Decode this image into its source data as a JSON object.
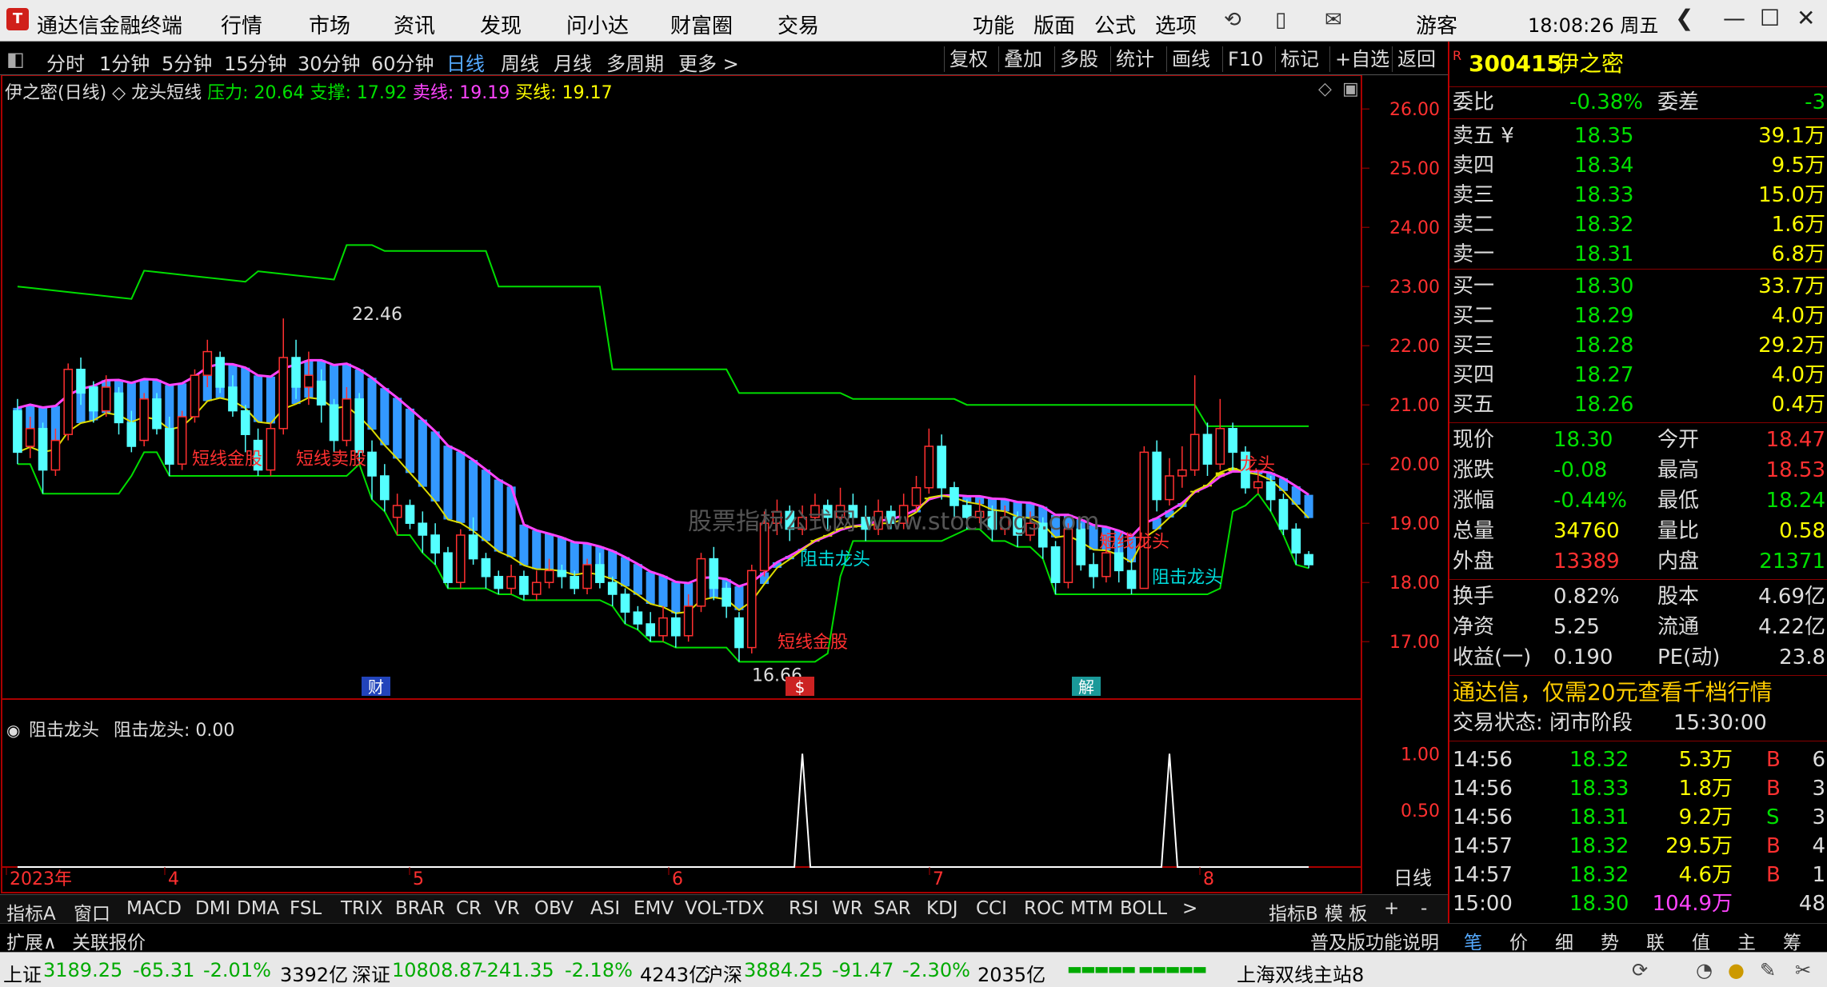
{
  "title_bar": {
    "app_title": "通达信金融终端",
    "menu": [
      "行情",
      "市场",
      "资讯",
      "发现",
      "问小达",
      "财富圈",
      "交易"
    ],
    "right_menu": [
      "功能",
      "版面",
      "公式",
      "选项"
    ],
    "user": "游客",
    "clock": "18:08:26 周五"
  },
  "periods": [
    "分时",
    "1分钟",
    "5分钟",
    "15分钟",
    "30分钟",
    "60分钟",
    "日线",
    "周线",
    "月线",
    "多周期",
    "更多 >"
  ],
  "active_period": "日线",
  "right_toolbar": [
    "复权",
    "叠加",
    "多股",
    "统计",
    "画线",
    "F10",
    "标记",
    "+自选",
    "返回"
  ],
  "chart_header": {
    "name": "伊之密(日线)",
    "indicator": "龙头短线",
    "pressure_label": "压力: 20.64",
    "support_label": "支撑: 17.92",
    "sell_label": "卖线: 19.19",
    "buy_label": "买线: 19.17"
  },
  "price_axis": [
    "26.00",
    "25.00",
    "24.00",
    "23.00",
    "22.00",
    "21.00",
    "20.00",
    "19.00",
    "18.00",
    "17.00"
  ],
  "annotations": {
    "high_label": "22.46",
    "low_label": "16.66",
    "a1": "短线金股",
    "a2": "短线卖股",
    "a3": "短线金股",
    "a4": "阻击龙头",
    "a5": "阻击龙头",
    "a6": "龙头",
    "a7": "短线龙头",
    "watermark": "股票指标公式网 www.stocklogs.com"
  },
  "event_tags": [
    "财",
    "$",
    "解"
  ],
  "sub_chart": {
    "title": "阻击龙头",
    "value_label": "阻击龙头: 0.00",
    "axis": [
      "1.00",
      "0.50"
    ]
  },
  "date_axis": [
    "2023年",
    "4",
    "5",
    "6",
    "7",
    "8"
  ],
  "date_axis_right": "日线",
  "indicator_tabs": [
    "指标A",
    "窗口",
    "MACD",
    "DMI",
    "DMA",
    "FSL",
    "TRIX",
    "BRAR",
    "CR",
    "VR",
    "OBV",
    "ASI",
    "EMV",
    "VOL-TDX",
    "RSI",
    "WR",
    "SAR",
    "KDJ",
    "CCI",
    "ROC",
    "MTM",
    "BOLL",
    ">",
    "指标B",
    "模 板",
    "+",
    "-"
  ],
  "expand_tabs": [
    "扩展∧",
    "关联报价"
  ],
  "quote": {
    "code": "300415",
    "name": "伊之密",
    "weibi_label": "委比",
    "weibi": "-0.38%",
    "weicha_label": "委差",
    "weicha": "-3",
    "asks": [
      {
        "label": "卖五 ¥",
        "price": "18.35",
        "vol": "39.1万"
      },
      {
        "label": "卖四",
        "price": "18.34",
        "vol": "9.5万"
      },
      {
        "label": "卖三",
        "price": "18.33",
        "vol": "15.0万"
      },
      {
        "label": "卖二",
        "price": "18.32",
        "vol": "1.6万"
      },
      {
        "label": "卖一",
        "price": "18.31",
        "vol": "6.8万"
      }
    ],
    "bids": [
      {
        "label": "买一",
        "price": "18.30",
        "vol": "33.7万"
      },
      {
        "label": "买二",
        "price": "18.29",
        "vol": "4.0万"
      },
      {
        "label": "买三",
        "price": "18.28",
        "vol": "29.2万"
      },
      {
        "label": "买四",
        "price": "18.27",
        "vol": "4.0万"
      },
      {
        "label": "买五",
        "price": "18.26",
        "vol": "0.4万"
      }
    ],
    "stats": [
      {
        "l1": "现价",
        "v1": "18.30",
        "l2": "今开",
        "v2": "18.47"
      },
      {
        "l1": "涨跌",
        "v1": "-0.08",
        "l2": "最高",
        "v2": "18.53"
      },
      {
        "l1": "涨幅",
        "v1": "-0.44%",
        "l2": "最低",
        "v2": "18.24"
      },
      {
        "l1": "总量",
        "v1": "34760",
        "l2": "量比",
        "v2": "0.58"
      },
      {
        "l1": "外盘",
        "v1": "13389",
        "l2": "内盘",
        "v2": "21371"
      }
    ],
    "stats2": [
      {
        "l1": "换手",
        "v1": "0.82%",
        "l2": "股本",
        "v2": "4.69亿"
      },
      {
        "l1": "净资",
        "v1": "5.25",
        "l2": "流通",
        "v2": "4.22亿"
      },
      {
        "l1": "收益(一)",
        "v1": "0.190",
        "l2": "PE(动)",
        "v2": "23.8"
      }
    ],
    "ad": "通达信，仅需20元查看千档行情",
    "trade_state_label": "交易状态: 闭市阶段",
    "trade_state_time": "15:30:00",
    "ticks": [
      {
        "t": "14:56",
        "p": "18.32",
        "v": "5.3万",
        "s": "B",
        "n": "6"
      },
      {
        "t": "14:56",
        "p": "18.33",
        "v": "1.8万",
        "s": "B",
        "n": "3"
      },
      {
        "t": "14:56",
        "p": "18.31",
        "v": "9.2万",
        "s": "S",
        "n": "3"
      },
      {
        "t": "14:57",
        "p": "18.32",
        "v": "29.5万",
        "s": "B",
        "n": "4"
      },
      {
        "t": "14:57",
        "p": "18.32",
        "v": "4.6万",
        "s": "B",
        "n": "1"
      },
      {
        "t": "15:00",
        "p": "18.30",
        "v": "104.9万",
        "s": "",
        "n": "48"
      }
    ],
    "tabs": [
      "笔",
      "价",
      "细",
      "势",
      "联",
      "值",
      "主",
      "筹"
    ],
    "func_note": "普及版功能说明"
  },
  "status_bar": {
    "sh_label": "上证",
    "sh_val": "3189.25",
    "sh_chg": "-65.31",
    "sh_pct": "-2.01%",
    "sh_amt": "3392亿",
    "sz_label": "深证",
    "sz_val": "10808.87",
    "sz_chg": "-241.35",
    "sz_pct": "-2.18%",
    "sz_amt": "4243亿",
    "hs_label": "沪深",
    "hs_val": "3884.25",
    "hs_chg": "-91.47",
    "hs_pct": "-2.30%",
    "hs_amt": "2035亿",
    "server": "上海双线主站8"
  },
  "chart_data": {
    "type": "candlestick",
    "ylim": [
      16.3,
      26.3
    ],
    "sub_ylim": [
      0,
      1.2
    ],
    "candles": [
      [
        20.9,
        20.2,
        21.1,
        20.0
      ],
      [
        20.3,
        20.6,
        20.8,
        20.1
      ],
      [
        20.6,
        19.9,
        20.7,
        19.5
      ],
      [
        19.9,
        20.4,
        20.6,
        19.8
      ],
      [
        20.5,
        21.6,
        21.7,
        20.4
      ],
      [
        21.6,
        21.2,
        21.8,
        21.0
      ],
      [
        21.3,
        20.9,
        21.4,
        20.7
      ],
      [
        20.9,
        21.3,
        21.5,
        20.8
      ],
      [
        21.2,
        20.7,
        21.3,
        20.5
      ],
      [
        20.7,
        20.3,
        20.9,
        20.2
      ],
      [
        20.4,
        21.1,
        21.2,
        20.3
      ],
      [
        21.1,
        20.6,
        21.2,
        20.5
      ],
      [
        20.6,
        20.0,
        20.8,
        19.8
      ],
      [
        20.0,
        20.8,
        20.9,
        19.9
      ],
      [
        20.8,
        21.5,
        21.6,
        20.7
      ],
      [
        21.5,
        21.9,
        22.1,
        21.3
      ],
      [
        21.8,
        21.3,
        21.9,
        21.2
      ],
      [
        21.3,
        20.9,
        21.5,
        20.8
      ],
      [
        20.9,
        20.5,
        21.0,
        20.2
      ],
      [
        20.4,
        19.9,
        20.6,
        19.8
      ],
      [
        19.9,
        20.6,
        20.7,
        19.8
      ],
      [
        20.6,
        21.8,
        22.46,
        20.5
      ],
      [
        21.8,
        21.3,
        22.1,
        21.1
      ],
      [
        21.3,
        21.5,
        21.9,
        21.0
      ],
      [
        21.4,
        21.0,
        21.6,
        20.7
      ],
      [
        21.0,
        20.4,
        21.1,
        20.2
      ],
      [
        20.4,
        21.1,
        21.3,
        20.3
      ],
      [
        21.1,
        20.2,
        21.2,
        20.0
      ],
      [
        20.2,
        19.8,
        20.4,
        19.4
      ],
      [
        19.8,
        19.4,
        20.0,
        19.2
      ],
      [
        19.1,
        19.3,
        19.5,
        18.8
      ],
      [
        19.3,
        19.0,
        19.4,
        18.9
      ],
      [
        19.0,
        18.8,
        19.2,
        18.5
      ],
      [
        18.8,
        18.5,
        19.0,
        18.3
      ],
      [
        18.5,
        18.0,
        18.6,
        17.9
      ],
      [
        18.0,
        18.8,
        18.9,
        17.9
      ],
      [
        18.8,
        18.4,
        19.1,
        18.3
      ],
      [
        18.4,
        18.1,
        18.5,
        17.9
      ],
      [
        18.1,
        17.9,
        18.2,
        17.8
      ],
      [
        17.9,
        18.1,
        18.3,
        17.8
      ],
      [
        18.1,
        17.8,
        18.2,
        17.7
      ],
      [
        17.8,
        18.0,
        18.2,
        17.7
      ],
      [
        18.0,
        18.2,
        18.4,
        17.9
      ],
      [
        18.2,
        18.1,
        18.3,
        17.9
      ],
      [
        18.1,
        17.9,
        18.2,
        17.8
      ],
      [
        17.9,
        18.3,
        18.4,
        17.8
      ],
      [
        18.3,
        18.0,
        18.5,
        17.9
      ],
      [
        18.0,
        17.8,
        18.1,
        17.6
      ],
      [
        17.8,
        17.5,
        17.9,
        17.3
      ],
      [
        17.5,
        17.3,
        17.6,
        17.2
      ],
      [
        17.3,
        17.1,
        17.5,
        17.0
      ],
      [
        17.1,
        17.4,
        17.6,
        17.0
      ],
      [
        17.4,
        17.1,
        17.5,
        16.9
      ],
      [
        17.1,
        17.6,
        17.8,
        17.0
      ],
      [
        17.6,
        18.4,
        18.5,
        17.5
      ],
      [
        18.4,
        17.9,
        18.6,
        17.7
      ],
      [
        17.9,
        17.6,
        18.0,
        17.4
      ],
      [
        17.4,
        16.9,
        17.5,
        16.66
      ],
      [
        16.9,
        18.2,
        18.3,
        16.8
      ],
      [
        18.2,
        19.0,
        19.2,
        18.1
      ],
      [
        19.0,
        19.2,
        19.4,
        18.8
      ],
      [
        19.2,
        18.9,
        19.3,
        18.7
      ],
      [
        18.9,
        19.1,
        19.3,
        18.8
      ],
      [
        19.1,
        19.3,
        19.5,
        19.0
      ],
      [
        19.3,
        19.1,
        19.4,
        18.9
      ],
      [
        19.1,
        19.3,
        19.6,
        19.0
      ],
      [
        19.3,
        19.1,
        19.5,
        18.9
      ],
      [
        19.1,
        18.9,
        19.3,
        18.7
      ],
      [
        18.9,
        19.2,
        19.4,
        18.8
      ],
      [
        19.2,
        19.0,
        19.3,
        18.9
      ],
      [
        19.0,
        19.3,
        19.5,
        18.9
      ],
      [
        19.3,
        19.6,
        19.8,
        19.2
      ],
      [
        19.6,
        20.3,
        20.6,
        19.5
      ],
      [
        20.3,
        19.6,
        20.5,
        19.4
      ],
      [
        19.6,
        19.3,
        19.7,
        19.1
      ],
      [
        19.3,
        19.1,
        19.4,
        18.9
      ],
      [
        19.1,
        19.2,
        19.4,
        19.0
      ],
      [
        19.2,
        18.9,
        19.3,
        18.7
      ],
      [
        18.9,
        19.1,
        19.3,
        18.8
      ],
      [
        19.1,
        18.8,
        19.2,
        18.6
      ],
      [
        18.8,
        19.0,
        19.2,
        18.7
      ],
      [
        19.0,
        18.6,
        19.1,
        18.4
      ],
      [
        18.6,
        18.0,
        18.7,
        17.8
      ],
      [
        18.0,
        18.9,
        19.0,
        17.9
      ],
      [
        18.9,
        18.3,
        19.0,
        18.2
      ],
      [
        18.3,
        18.1,
        18.5,
        17.9
      ],
      [
        18.1,
        18.5,
        18.8,
        18.0
      ],
      [
        18.5,
        18.2,
        18.7,
        18.0
      ],
      [
        18.2,
        17.9,
        18.4,
        17.8
      ],
      [
        17.9,
        20.2,
        20.3,
        17.9
      ],
      [
        20.2,
        19.4,
        20.4,
        19.2
      ],
      [
        19.4,
        19.8,
        20.1,
        19.3
      ],
      [
        19.8,
        19.9,
        20.3,
        19.6
      ],
      [
        19.9,
        20.5,
        21.5,
        19.8
      ],
      [
        20.5,
        20.0,
        20.7,
        19.8
      ],
      [
        20.0,
        20.6,
        21.1,
        19.9
      ],
      [
        20.6,
        20.2,
        20.7,
        19.9
      ],
      [
        20.2,
        19.6,
        20.3,
        19.5
      ],
      [
        19.6,
        19.7,
        19.9,
        19.5
      ],
      [
        19.7,
        19.4,
        19.8,
        19.2
      ],
      [
        19.4,
        18.9,
        19.5,
        18.8
      ],
      [
        18.9,
        18.5,
        19.0,
        18.3
      ],
      [
        18.47,
        18.3,
        18.53,
        18.24
      ]
    ],
    "pressure_line": [
      23.0,
      23.5,
      23.7,
      23.6,
      23.0,
      21.6,
      21.2,
      21.1,
      21.0,
      21.0,
      20.64
    ],
    "support_line": [
      17.0,
      17.4,
      17.9,
      17.92
    ],
    "sub_signal": [
      0,
      1,
      0,
      1,
      0
    ]
  }
}
